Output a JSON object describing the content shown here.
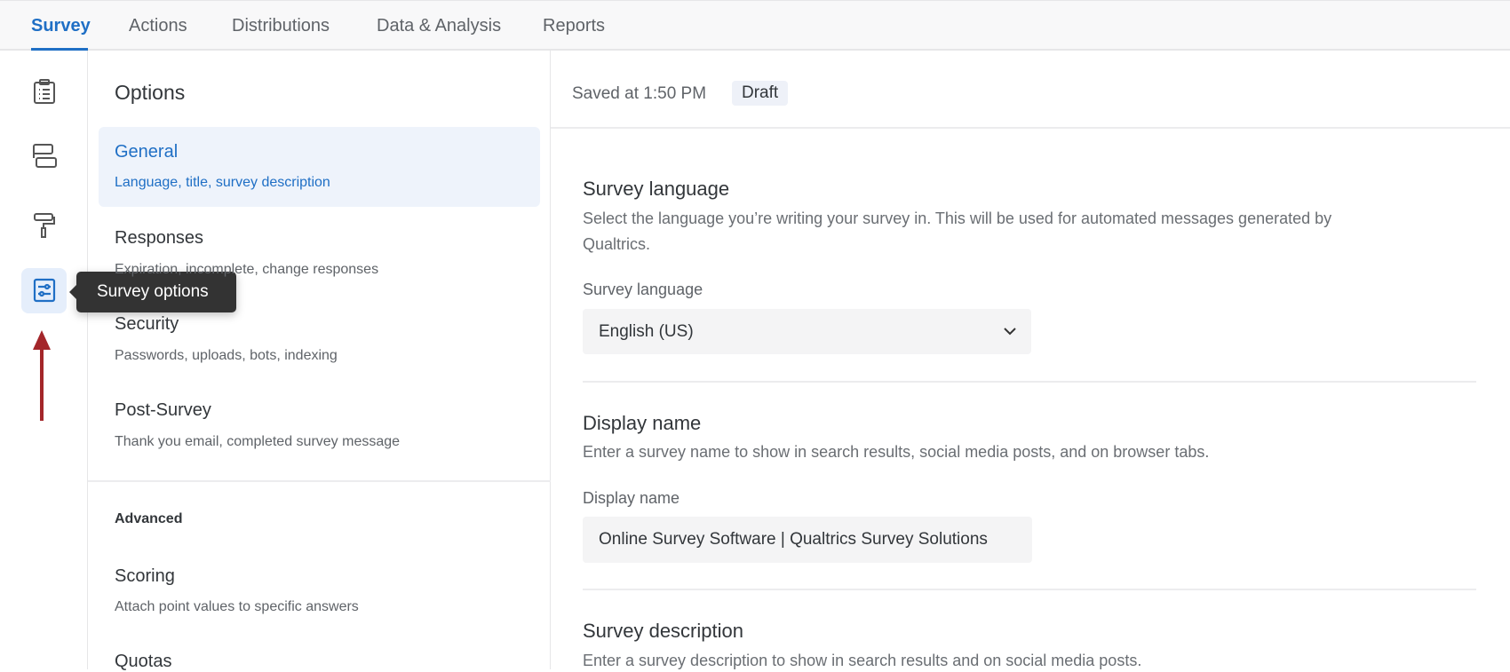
{
  "tabs": [
    {
      "label": "Survey"
    },
    {
      "label": "Actions"
    },
    {
      "label": "Distributions"
    },
    {
      "label": "Data & Analysis"
    },
    {
      "label": "Reports"
    }
  ],
  "rail": {
    "icons": [
      "clipboard-icon",
      "blocks-icon",
      "paint-roller-icon",
      "sliders-icon"
    ],
    "tooltip": "Survey options",
    "accent": "#1f6fc5",
    "arrow_color": "#a3262a"
  },
  "options": {
    "title": "Options",
    "items": [
      {
        "title": "General",
        "subtitle": "Language, title, survey description"
      },
      {
        "title": "Responses",
        "subtitle": "Expiration, incomplete, change responses"
      },
      {
        "title": "Security",
        "subtitle": "Passwords, uploads, bots, indexing"
      },
      {
        "title": "Post-Survey",
        "subtitle": "Thank you email, completed survey message"
      }
    ],
    "advanced_label": "Advanced",
    "advanced_items": [
      {
        "title": "Scoring",
        "subtitle": "Attach point values to specific answers"
      },
      {
        "title": "Quotas"
      }
    ]
  },
  "header": {
    "saved": "Saved at 1:50 PM",
    "status": "Draft"
  },
  "sections": {
    "language": {
      "heading": "Survey language",
      "desc1": "Select the language you’re writing your survey in. This will be used for automated messages generated by",
      "desc2": "Qualtrics.",
      "label": "Survey language",
      "value": "English (US)"
    },
    "display": {
      "heading": "Display name",
      "desc": "Enter a survey name to show in search results, social media posts, and on browser tabs.",
      "label": "Display name",
      "value": "Online Survey Software | Qualtrics Survey Solutions"
    },
    "description": {
      "heading": "Survey description",
      "desc": "Enter a survey description to show in search results and on social media posts."
    }
  }
}
